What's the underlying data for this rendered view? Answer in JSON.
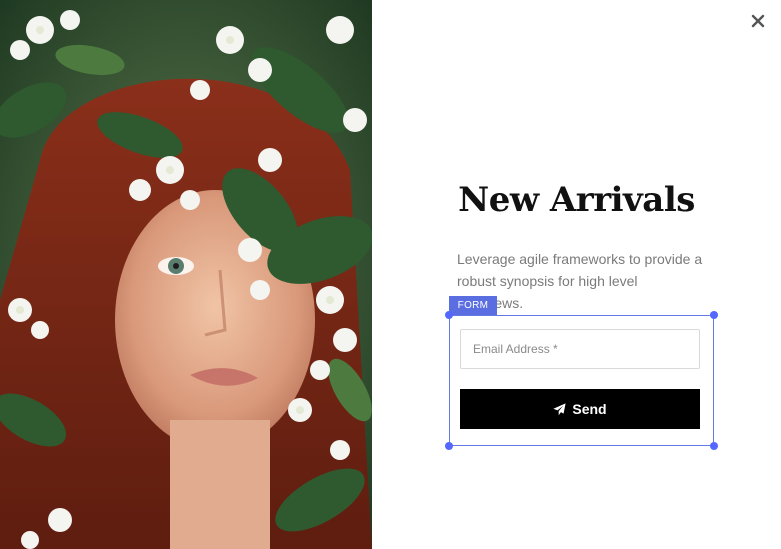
{
  "popup": {
    "close_icon": "close-icon",
    "title": "New Arrivals",
    "subtitle": "Leverage agile frameworks to provide a robust synopsis for high level overviews.",
    "form_tag": "FORM",
    "email": {
      "placeholder": "Email Address *",
      "value": ""
    },
    "send_label": "Send",
    "send_icon": "paper-plane-icon"
  },
  "colors": {
    "accent": "#5b6ee1",
    "button_bg": "#000000",
    "title": "#111111",
    "subtitle": "#7a7a7a"
  }
}
